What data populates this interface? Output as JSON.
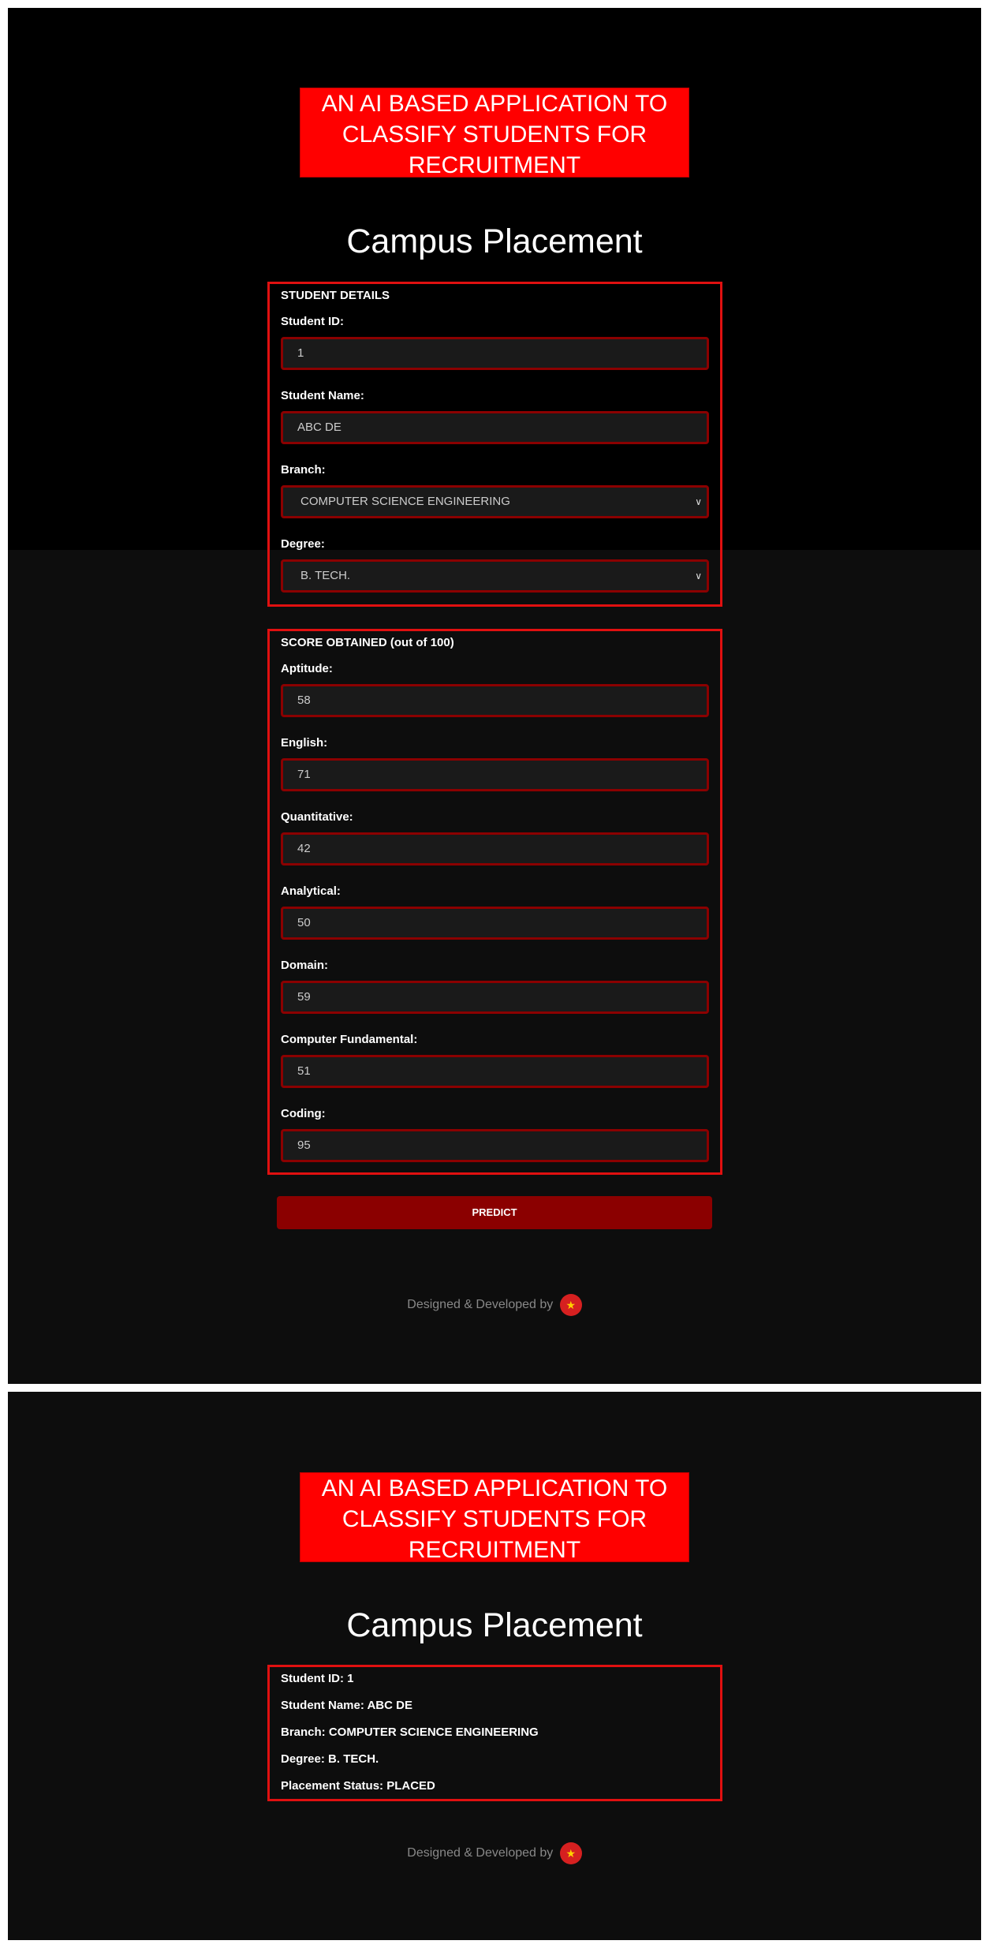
{
  "banner": "AN AI BASED APPLICATION TO CLASSIFY STUDENTS FOR RECRUITMENT",
  "title": "Campus Placement",
  "student_details": {
    "legend": "STUDENT DETAILS",
    "id_label": "Student ID:",
    "id_value": "1",
    "name_label": "Student Name:",
    "name_value": "ABC DE",
    "branch_label": "Branch:",
    "branch_value": "COMPUTER SCIENCE ENGINEERING",
    "degree_label": "Degree:",
    "degree_value": "B. TECH."
  },
  "scores": {
    "legend": "SCORE OBTAINED (out of 100)",
    "items": [
      {
        "label": "Aptitude:",
        "value": "58"
      },
      {
        "label": "English:",
        "value": "71"
      },
      {
        "label": "Quantitative:",
        "value": "42"
      },
      {
        "label": "Analytical:",
        "value": "50"
      },
      {
        "label": "Domain:",
        "value": "59"
      },
      {
        "label": "Computer Fundamental:",
        "value": "51"
      },
      {
        "label": "Coding:",
        "value": "95"
      }
    ]
  },
  "predict_label": "PREDICT",
  "footer": "Designed & Developed by",
  "logo_icon": "logo-icon",
  "result": {
    "lines": [
      "Student ID: 1",
      "Student Name: ABC DE",
      "Branch: COMPUTER SCIENCE ENGINEERING",
      "Degree: B. TECH.",
      "Placement Status: PLACED"
    ]
  },
  "colors": {
    "accent": "#ff0000",
    "border": "#e01010",
    "button": "#8b0000",
    "background": "#0d0d0d"
  }
}
